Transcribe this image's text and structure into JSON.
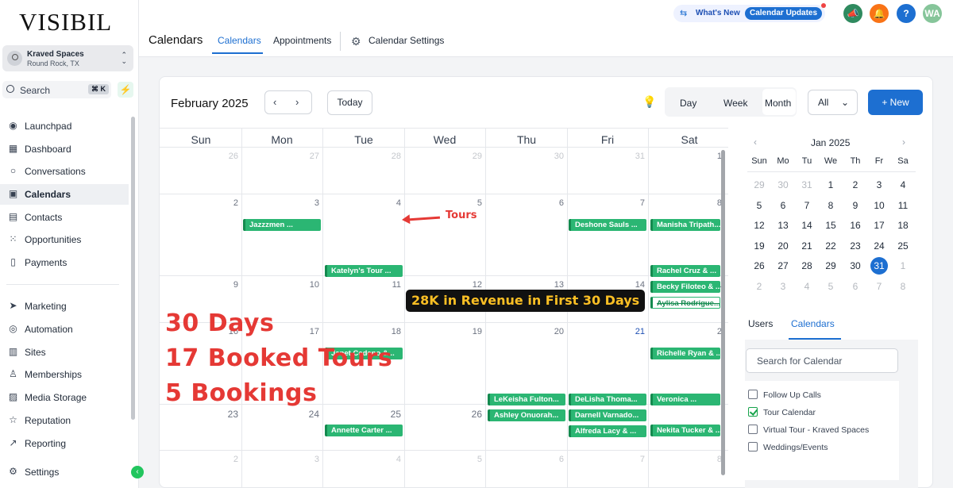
{
  "brand": {
    "logo": "VISIBIL"
  },
  "location": {
    "name": "Kraved Spaces",
    "city": "Round Rock, TX"
  },
  "sidebar": {
    "search_label": "Search",
    "search_kbd": "⌘ K",
    "items": [
      {
        "label": "Launchpad",
        "icon": "rocket-icon"
      },
      {
        "label": "Dashboard",
        "icon": "grid-icon"
      },
      {
        "label": "Conversations",
        "icon": "chat-icon"
      },
      {
        "label": "Calendars",
        "icon": "calendar-icon"
      },
      {
        "label": "Contacts",
        "icon": "contacts-icon"
      },
      {
        "label": "Opportunities",
        "icon": "opportunities-icon"
      },
      {
        "label": "Payments",
        "icon": "payments-icon"
      },
      {
        "label": "Marketing",
        "icon": "send-icon"
      },
      {
        "label": "Automation",
        "icon": "automation-icon"
      },
      {
        "label": "Sites",
        "icon": "sites-icon"
      },
      {
        "label": "Memberships",
        "icon": "memberships-icon"
      },
      {
        "label": "Media Storage",
        "icon": "image-icon"
      },
      {
        "label": "Reputation",
        "icon": "star-icon"
      },
      {
        "label": "Reporting",
        "icon": "chart-icon"
      },
      {
        "label": "Settings",
        "icon": "gear-icon"
      }
    ]
  },
  "topbar": {
    "page_title": "Calendars",
    "tabs": [
      "Calendars",
      "Appointments"
    ],
    "settings_label": "Calendar Settings",
    "whats_new": "What's New",
    "updates_pill": "Calendar Updates",
    "avatar": "WA",
    "colors": {
      "accent": "#1d6fd1",
      "event": "#2bb673"
    }
  },
  "toolbar": {
    "month": "February 2025",
    "today": "Today",
    "views": [
      "Day",
      "Week",
      "Month"
    ],
    "filter": "All",
    "new_label": "New"
  },
  "calendar": {
    "weekdays": [
      "Sun",
      "Mon",
      "Tue",
      "Wed",
      "Thu",
      "Fri",
      "Sat"
    ],
    "weeks": [
      [
        "26",
        "27",
        "28",
        "29",
        "30",
        "31",
        "1"
      ],
      [
        "2",
        "3",
        "4",
        "5",
        "6",
        "7",
        "8"
      ],
      [
        "9",
        "10",
        "11",
        "12",
        "13",
        "14",
        "1"
      ],
      [
        "16",
        "17",
        "18",
        "19",
        "20",
        "21",
        "2"
      ],
      [
        "23",
        "24",
        "25",
        "26",
        "27",
        "28",
        ""
      ],
      [
        "2",
        "3",
        "4",
        "5",
        "6",
        "7",
        "8"
      ]
    ],
    "events": [
      "Jazzzmen ...",
      "Deshone Sauls ...",
      "Manisha Tripath...",
      "Katelyn's Tour ...",
      "Rachel Cruz & ...",
      "Becky Filoteo & ...",
      "Aylisa Rodrigue...",
      "Janet Cedeno &...",
      "Richelle Ryan & ...",
      "LeKeisha Fulton...",
      "DeLisha Thoma...",
      "Veronica ...",
      "Ashley Onuorah...",
      "Darnell Varnado...",
      "Alfreda Lacy & ...",
      "Annette Carter ...",
      "Nekita Tucker & ..."
    ]
  },
  "overlay": {
    "tours": "Tours",
    "revenue": "28K in Revenue in First 30 Days",
    "days": "30 Days",
    "booked": "17 Booked Tours",
    "bookings": "5 Bookings"
  },
  "mini_calendar": {
    "title": "Jan 2025",
    "weekdays": [
      "Sun",
      "Mo",
      "Tu",
      "We",
      "Th",
      "Fr",
      "Sa"
    ],
    "days": [
      "29",
      "30",
      "31",
      "1",
      "2",
      "3",
      "4",
      "5",
      "6",
      "7",
      "8",
      "9",
      "10",
      "11",
      "12",
      "13",
      "14",
      "15",
      "16",
      "17",
      "18",
      "19",
      "20",
      "21",
      "22",
      "23",
      "24",
      "25",
      "26",
      "27",
      "28",
      "29",
      "30",
      "31",
      "1",
      "2",
      "3",
      "4",
      "5",
      "6",
      "7",
      "8"
    ]
  },
  "panel": {
    "tabs": [
      "Users",
      "Calendars"
    ],
    "search_placeholder": "Search for Calendar",
    "calendars": [
      {
        "label": "Follow Up Calls",
        "checked": false
      },
      {
        "label": "Tour Calendar",
        "checked": true
      },
      {
        "label": "Virtual Tour - Kraved Spaces",
        "checked": false
      },
      {
        "label": "Weddings/Events",
        "checked": false
      }
    ]
  }
}
